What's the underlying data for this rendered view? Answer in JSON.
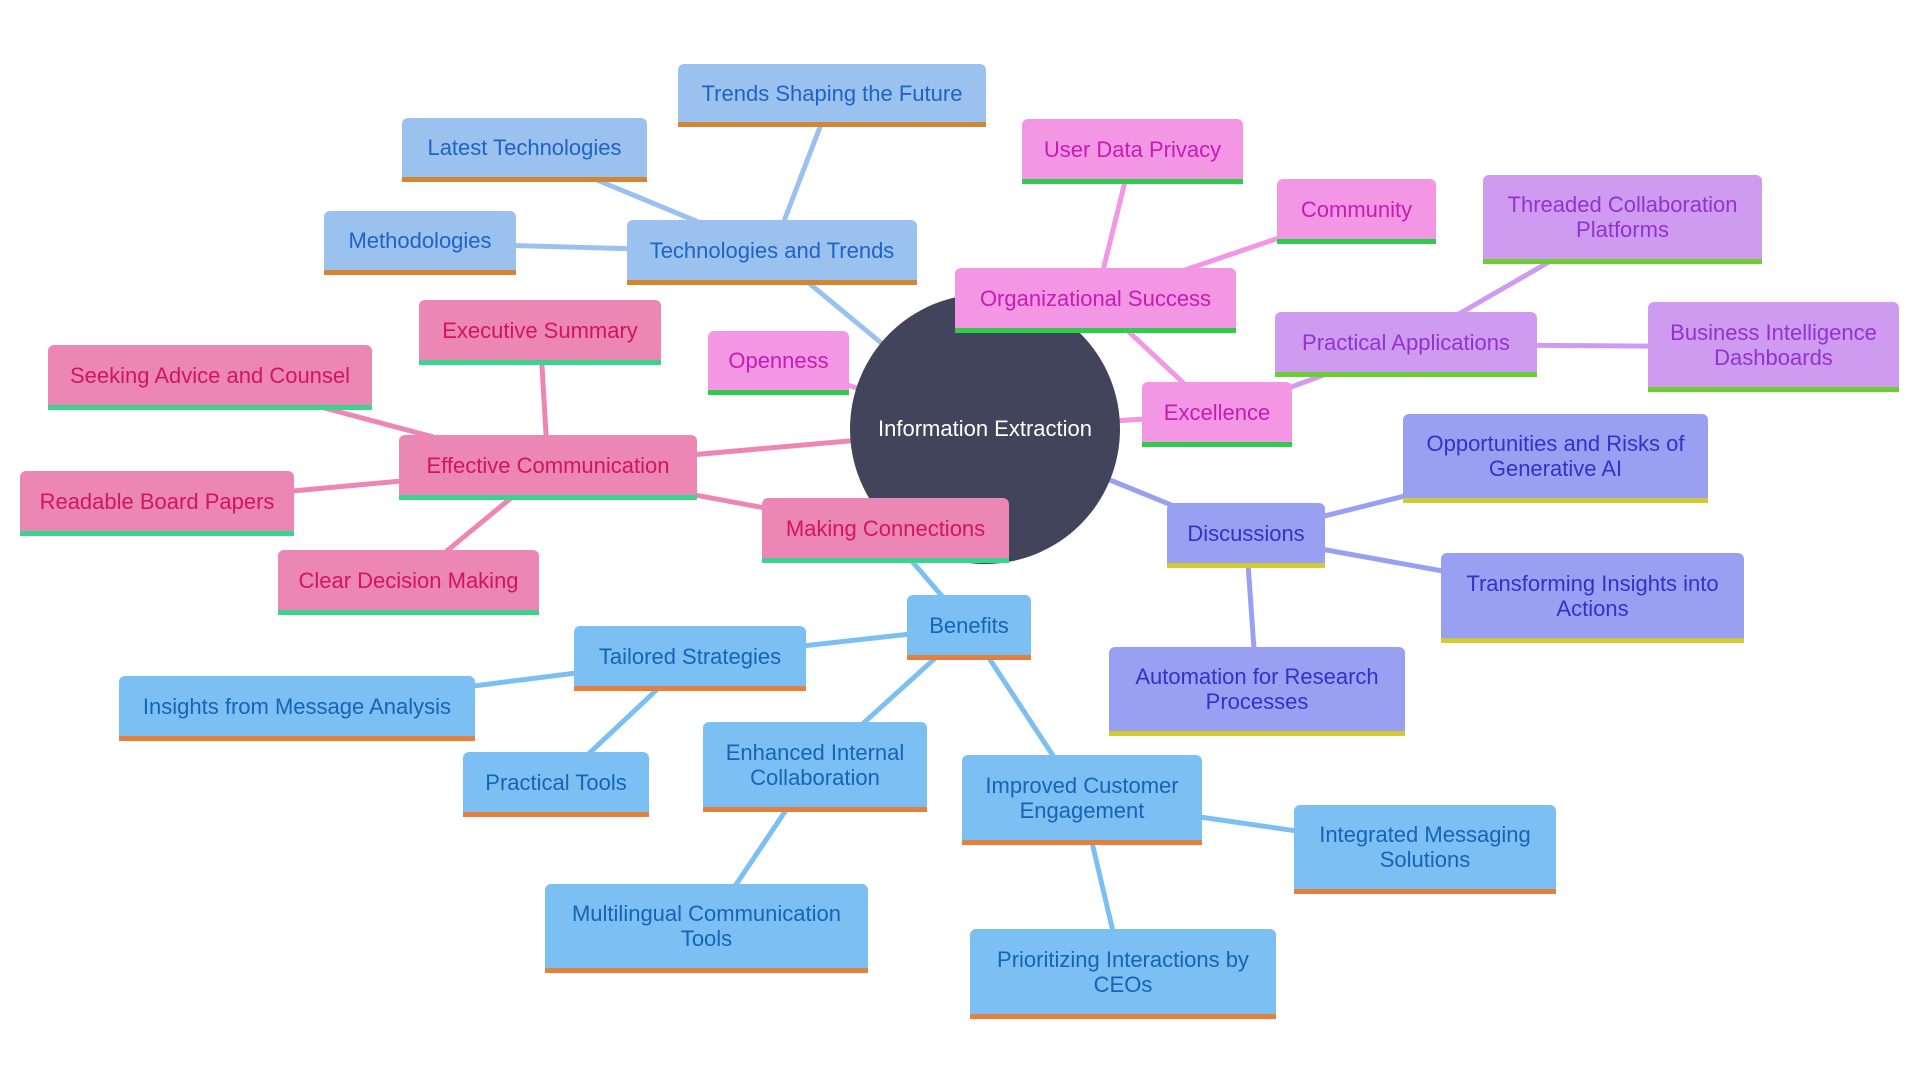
{
  "title": "Information Extraction",
  "colors": {
    "center": "#41445b",
    "tech": "#9bc2ee",
    "org": "#f397e4",
    "practical": "#cf9bf1",
    "discussions": "#9aa0f1",
    "communication": "#ec86b4",
    "benefits": "#7cbff2"
  },
  "nodes": {
    "technologies_and_trends": "Technologies and Trends",
    "trends_shaping_future": "Trends Shaping the Future",
    "latest_technologies": "Latest Technologies",
    "methodologies": "Methodologies",
    "openness": "Openness",
    "organizational_success": "Organizational Success",
    "user_data_privacy": "User Data Privacy",
    "community": "Community",
    "excellence": "Excellence",
    "practical_applications": "Practical Applications",
    "threaded_collaboration": "Threaded Collaboration Platforms",
    "business_intelligence": "Business Intelligence Dashboards",
    "discussions": "Discussions",
    "opportunities_risks": "Opportunities and Risks of Generative AI",
    "transforming_insights": "Transforming Insights into Actions",
    "automation_research": "Automation for Research Processes",
    "effective_communication": "Effective Communication",
    "executive_summary": "Executive Summary",
    "seeking_advice": "Seeking Advice and Counsel",
    "readable_board_papers": "Readable Board Papers",
    "clear_decision_making": "Clear Decision Making",
    "making_connections": "Making Connections",
    "benefits": "Benefits",
    "tailored_strategies": "Tailored Strategies",
    "insights_message_analysis": "Insights from Message Analysis",
    "practical_tools": "Practical Tools",
    "enhanced_internal_collaboration": "Enhanced Internal Collaboration",
    "multilingual_tools": "Multilingual Communication Tools",
    "improved_customer_engagement": "Improved Customer Engagement",
    "integrated_messaging": "Integrated Messaging Solutions",
    "prioritizing_interactions": "Prioritizing Interactions by CEOs"
  },
  "edges": [
    [
      "center",
      "technologies_and_trends"
    ],
    [
      "technologies_and_trends",
      "trends_shaping_future"
    ],
    [
      "technologies_and_trends",
      "latest_technologies"
    ],
    [
      "technologies_and_trends",
      "methodologies"
    ],
    [
      "center",
      "openness"
    ],
    [
      "center",
      "excellence"
    ],
    [
      "excellence",
      "organizational_success"
    ],
    [
      "organizational_success",
      "user_data_privacy"
    ],
    [
      "organizational_success",
      "community"
    ],
    [
      "excellence",
      "practical_applications"
    ],
    [
      "practical_applications",
      "threaded_collaboration"
    ],
    [
      "practical_applications",
      "business_intelligence"
    ],
    [
      "center",
      "discussions"
    ],
    [
      "discussions",
      "opportunities_risks"
    ],
    [
      "discussions",
      "transforming_insights"
    ],
    [
      "discussions",
      "automation_research"
    ],
    [
      "center",
      "effective_communication"
    ],
    [
      "effective_communication",
      "executive_summary"
    ],
    [
      "effective_communication",
      "seeking_advice"
    ],
    [
      "effective_communication",
      "readable_board_papers"
    ],
    [
      "effective_communication",
      "clear_decision_making"
    ],
    [
      "effective_communication",
      "making_connections"
    ],
    [
      "making_connections",
      "benefits"
    ],
    [
      "benefits",
      "tailored_strategies"
    ],
    [
      "tailored_strategies",
      "insights_message_analysis"
    ],
    [
      "tailored_strategies",
      "practical_tools"
    ],
    [
      "benefits",
      "enhanced_internal_collaboration"
    ],
    [
      "enhanced_internal_collaboration",
      "multilingual_tools"
    ],
    [
      "benefits",
      "improved_customer_engagement"
    ],
    [
      "improved_customer_engagement",
      "integrated_messaging"
    ],
    [
      "improved_customer_engagement",
      "prioritizing_interactions"
    ]
  ]
}
